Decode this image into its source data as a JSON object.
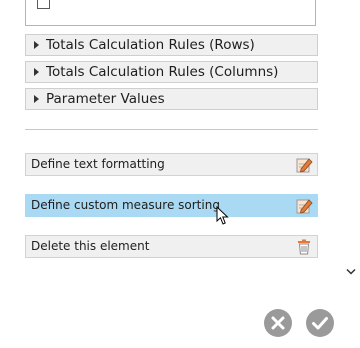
{
  "sections": [
    {
      "label": "Totals Calculation Rules (Rows)",
      "name": "section-totals-rows"
    },
    {
      "label": "Totals Calculation Rules (Columns)",
      "name": "section-totals-columns"
    },
    {
      "label": "Parameter Values",
      "name": "section-parameter-values"
    }
  ],
  "actions": [
    {
      "label": "Define text formatting",
      "icon": "edit-icon"
    },
    {
      "label": "Define custom measure sorting",
      "icon": "edit-icon",
      "highlighted": true
    },
    {
      "label": "Delete this element",
      "icon": "trash-icon"
    }
  ],
  "colors": {
    "highlight": "#a9d9f3",
    "panel": "#f0f0f0",
    "edit_icon": "#e07b39",
    "round_button": "#9a9a9a"
  },
  "footer": {
    "cancel_icon": "close-icon",
    "confirm_icon": "checkmark-icon"
  }
}
